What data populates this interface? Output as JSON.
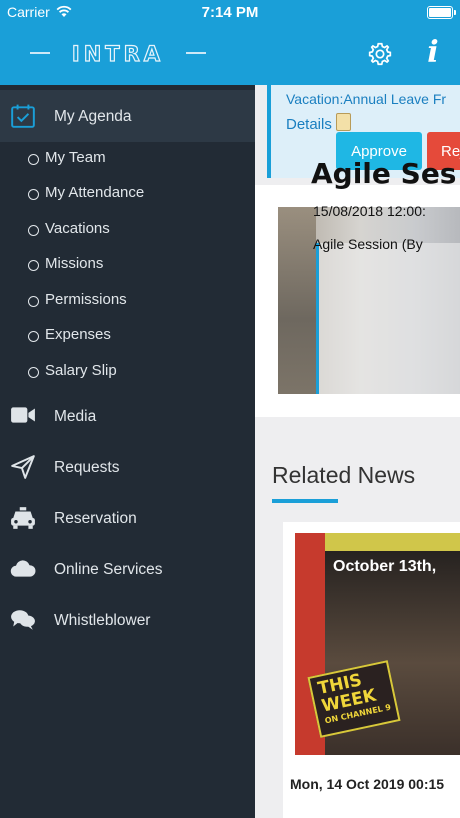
{
  "status_bar": {
    "carrier": "Carrier",
    "time": "7:14 PM"
  },
  "header": {
    "logo_text": "INTRA",
    "settings_icon": "gear-icon",
    "info_icon": "info-icon",
    "info_glyph": "i"
  },
  "sidebar": {
    "agenda": {
      "label": "My Agenda",
      "icon": "calendar-check-icon"
    },
    "sub_items": [
      {
        "label": "My Team"
      },
      {
        "label": "My Attendance"
      },
      {
        "label": "Vacations"
      },
      {
        "label": "Missions"
      },
      {
        "label": "Permissions"
      },
      {
        "label": "Expenses"
      },
      {
        "label": "Salary Slip"
      }
    ],
    "items": [
      {
        "label": "Media",
        "icon": "video-camera-icon"
      },
      {
        "label": "Requests",
        "icon": "paper-plane-icon"
      },
      {
        "label": "Reservation",
        "icon": "taxi-icon"
      },
      {
        "label": "Online Services",
        "icon": "cloud-icon"
      },
      {
        "label": "Whistleblower",
        "icon": "chat-bubbles-icon"
      }
    ]
  },
  "request": {
    "text": "Vacation:Annual Leave Fr",
    "details_label": "Details",
    "approve_label": "Approve",
    "reject_label": "Rejec"
  },
  "event": {
    "title": "Agile Ses",
    "date": "15/08/2018 12:00:",
    "desc": "Agile Session (By"
  },
  "related_news": {
    "title": "Related News",
    "card": {
      "caption": "October 13th,",
      "badge_line1": "THIS",
      "badge_line2": "WEEK",
      "badge_line3": "ON CHANNEL 9",
      "date": "Mon, 14 Oct 2019 00:15"
    }
  },
  "colors": {
    "brand_blue": "#1a9fd8",
    "sidebar_bg": "#222b35",
    "approve": "#1fb7e4",
    "reject": "#e54a3a"
  }
}
